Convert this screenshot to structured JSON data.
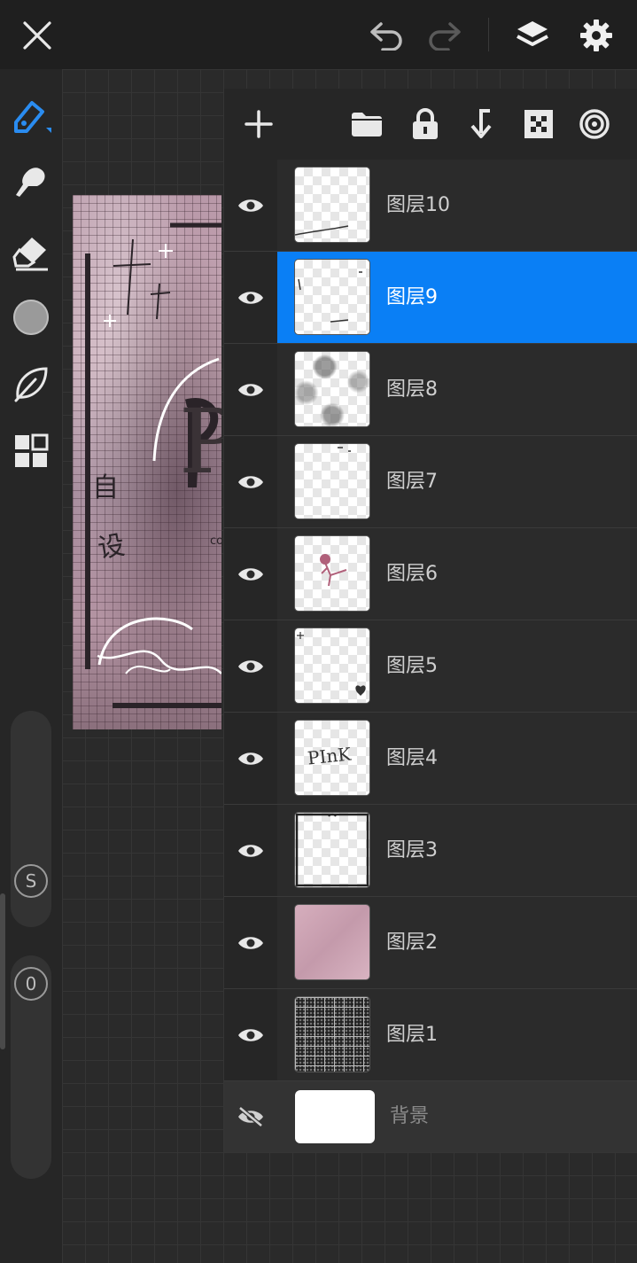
{
  "toolbar": {
    "close_icon": "close-icon",
    "undo_icon": "undo-icon",
    "redo_icon": "redo-icon",
    "layers_icon": "layers-icon",
    "settings_icon": "gear-icon"
  },
  "sidebar": {
    "tools": [
      "brush-icon",
      "smudge-icon",
      "eraser-icon",
      "color-icon",
      "leaf-icon",
      "grid-icon"
    ],
    "size_label": "S",
    "opacity_label": "0"
  },
  "layers_panel": {
    "toolbar_icons": [
      "add-icon",
      "folder-icon",
      "lock-icon",
      "merge-down-icon",
      "checker-icon",
      "blend-icon"
    ],
    "layers": [
      {
        "name": "图层10",
        "visible": true,
        "selected": false
      },
      {
        "name": "图层9",
        "visible": true,
        "selected": true
      },
      {
        "name": "图层8",
        "visible": true,
        "selected": false
      },
      {
        "name": "图层7",
        "visible": true,
        "selected": false
      },
      {
        "name": "图层6",
        "visible": true,
        "selected": false
      },
      {
        "name": "图层5",
        "visible": true,
        "selected": false
      },
      {
        "name": "图层4",
        "visible": true,
        "selected": false
      },
      {
        "name": "图层3",
        "visible": true,
        "selected": false
      },
      {
        "name": "图层2",
        "visible": true,
        "selected": false
      },
      {
        "name": "图层1",
        "visible": true,
        "selected": false
      }
    ],
    "background": {
      "name": "背景",
      "visible": false
    }
  },
  "artwork": {
    "text_top": "自",
    "text_mid": "设",
    "text_small": "co",
    "letter": "P"
  },
  "thumb4_text": "PInK",
  "colors": {
    "accent": "#0a7ff5",
    "panel": "#262626",
    "row": "#2b2b2b"
  }
}
